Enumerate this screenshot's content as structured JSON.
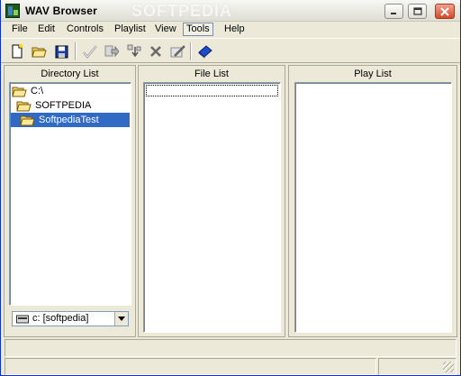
{
  "window": {
    "title": "WAV Browser",
    "watermark": "SOFTPEDIA",
    "colors": {
      "title_bg": "#ebeae3",
      "face": "#ece9d8",
      "selection": "#316ac5",
      "close": "#cf4b2c"
    }
  },
  "menu": {
    "items": [
      {
        "label": "File"
      },
      {
        "label": "Edit"
      },
      {
        "label": "Controls"
      },
      {
        "label": "Playlist"
      },
      {
        "label": "View"
      },
      {
        "label": "Tools",
        "active": true
      },
      {
        "label": "Help"
      }
    ]
  },
  "toolbar": {
    "tools": [
      {
        "icon": "new-document-icon"
      },
      {
        "icon": "open-folder-icon"
      },
      {
        "icon": "save-disk-icon"
      },
      {
        "icon": "check-icon"
      },
      {
        "icon": "export-icon"
      },
      {
        "icon": "move-icon"
      },
      {
        "icon": "delete-icon"
      },
      {
        "icon": "edit-icon"
      },
      {
        "icon": "book-icon"
      }
    ]
  },
  "panels": {
    "directory": {
      "header": "Directory List",
      "items": [
        {
          "label": "C:\\",
          "level": 0
        },
        {
          "label": "SOFTPEDIA",
          "level": 1
        },
        {
          "label": "SoftpediaTest",
          "level": 2,
          "selected": true
        }
      ],
      "drive": "c: [softpedia]"
    },
    "files": {
      "header": "File List"
    },
    "playlist": {
      "header": "Play List"
    }
  }
}
